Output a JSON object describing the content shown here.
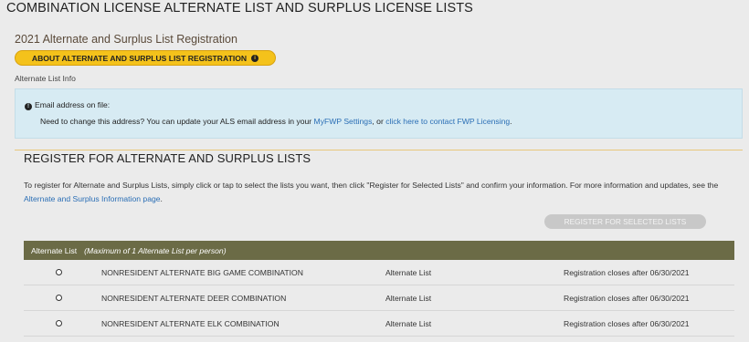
{
  "page_title": "COMBINATION LICENSE ALTERNATE LIST AND SURPLUS LICENSE LISTS",
  "subtitle": "2021 Alternate and Surplus List Registration",
  "about_button": "ABOUT ALTERNATE AND SURPLUS LIST REGISTRATION",
  "alternate_list_info_label": "Alternate List Info",
  "info_box": {
    "email_label": "Email address on file:",
    "change_text_pre": "Need to change this address? You can update your ALS email address in your ",
    "myfwp_link": "MyFWP Settings",
    "change_text_mid": ", or ",
    "contact_link": "click here to contact FWP Licensing",
    "change_text_post": "."
  },
  "section_title": "REGISTER FOR ALTERNATE AND SURPLUS LISTS",
  "description": {
    "text_pre": "To register for Alternate and Surplus Lists, simply click or tap to select the lists you want, then click \"Register for Selected Lists\" and confirm your information. For more information and updates, see the ",
    "link": "Alternate and Surplus Information page",
    "text_post": "."
  },
  "register_button": "REGISTER FOR SELECTED LISTS",
  "table": {
    "header_label": "Alternate List",
    "header_note": "(Maximum of 1 Alternate List per person)",
    "rows": [
      {
        "name": "NONRESIDENT ALTERNATE BIG GAME COMBINATION",
        "type": "Alternate List",
        "closes": "Registration closes after 06/30/2021"
      },
      {
        "name": "NONRESIDENT ALTERNATE DEER COMBINATION",
        "type": "Alternate List",
        "closes": "Registration closes after 06/30/2021"
      },
      {
        "name": "NONRESIDENT ALTERNATE ELK COMBINATION",
        "type": "Alternate List",
        "closes": "Registration closes after 06/30/2021"
      }
    ]
  },
  "colors": {
    "accent_yellow": "#f4c21b",
    "header_olive": "#6b6b46",
    "info_blue": "#d7ebf3",
    "link_blue": "#2a6eb5"
  }
}
